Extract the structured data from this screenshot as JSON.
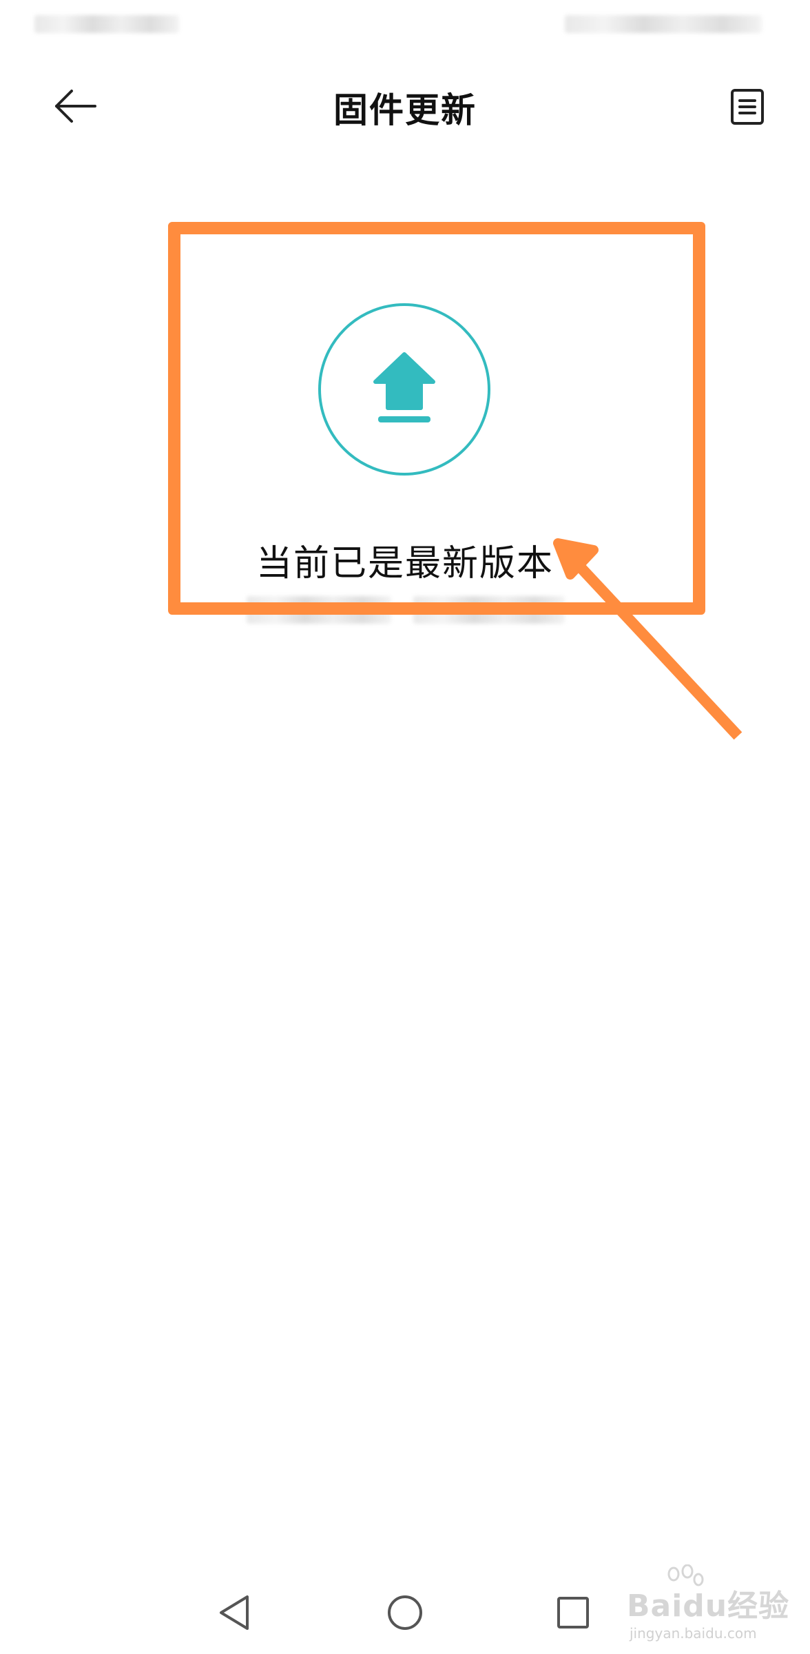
{
  "header": {
    "title": "固件更新",
    "back_icon": "arrow-left-icon",
    "log_icon": "document-list-icon"
  },
  "main": {
    "icon": "upload-arrow-icon",
    "status_text": "当前已是最新版本"
  },
  "navbar": {
    "back_icon": "triangle-back-icon",
    "home_icon": "circle-home-icon",
    "recent_icon": "square-recents-icon"
  },
  "watermark": {
    "main": "Baidu经验",
    "sub": "jingyan.baidu.com"
  },
  "colors": {
    "accent": "#33bbbf",
    "annotation": "#ff8c3e",
    "text": "#111111",
    "nav_icon": "#555555"
  }
}
